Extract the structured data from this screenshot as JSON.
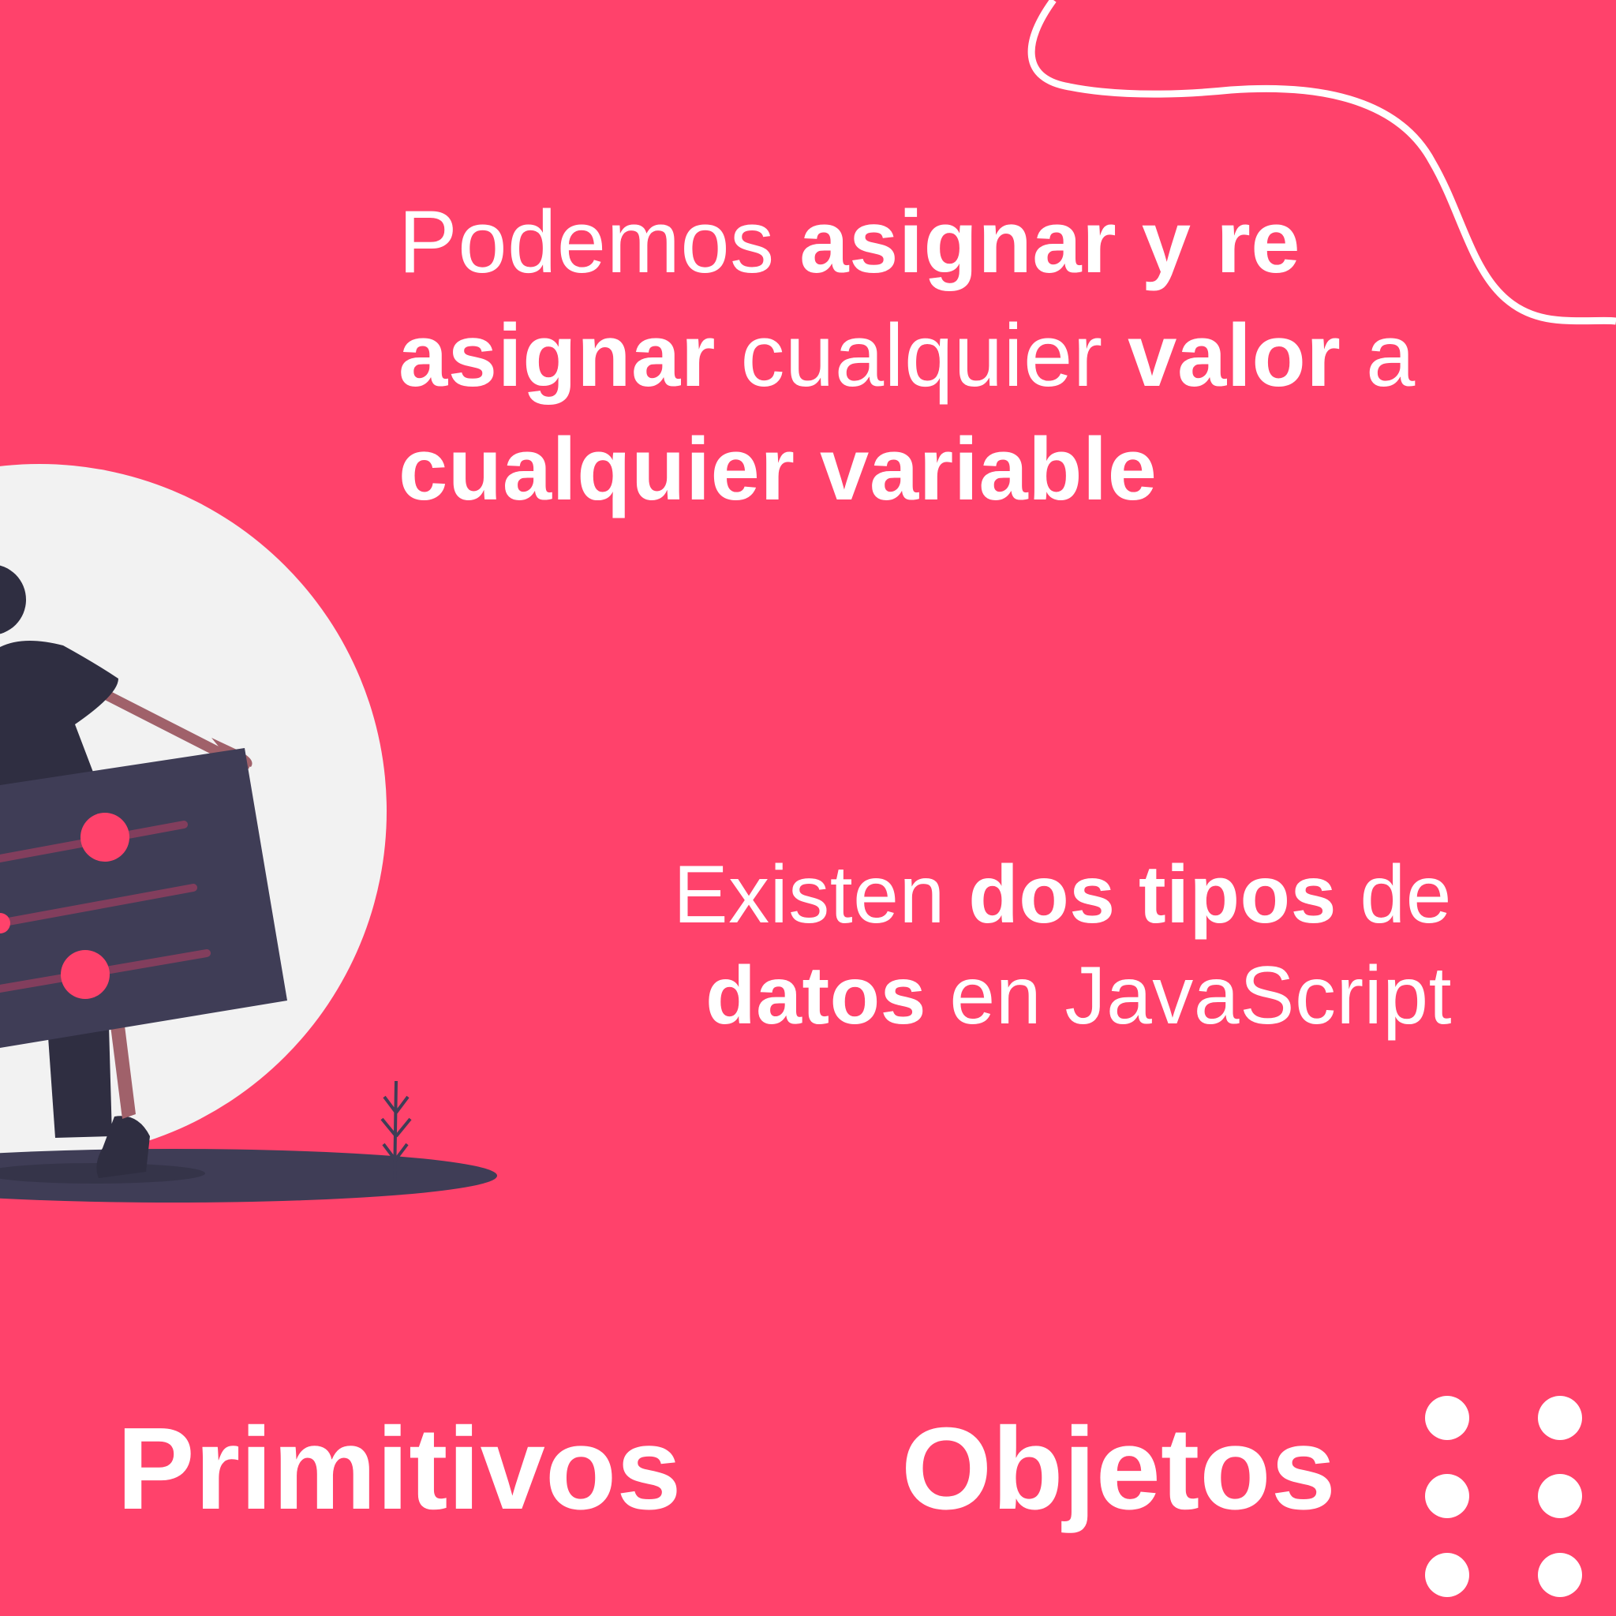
{
  "intro": {
    "p1": "Podemos ",
    "b1": "asignar y re asignar",
    "p2": " cualquier ",
    "b2": "valor",
    "p3": " a ",
    "b3": "cualquier variable"
  },
  "types": {
    "p1": "Existen ",
    "b1": "dos tipos",
    "p2": " de ",
    "b2": "datos",
    "p3": " en JavaScript"
  },
  "labels": {
    "primitives": "Primitivos",
    "objects": "Objetos"
  },
  "colors": {
    "background": "#ff426b",
    "circle": "#f2f2f2",
    "dark": "#3f3d56",
    "skin": "#a0616a",
    "text": "#ffffff"
  },
  "icons": {
    "illustration": "person-with-settings-panel-illustration",
    "decoration": "dot-grid-decoration"
  }
}
